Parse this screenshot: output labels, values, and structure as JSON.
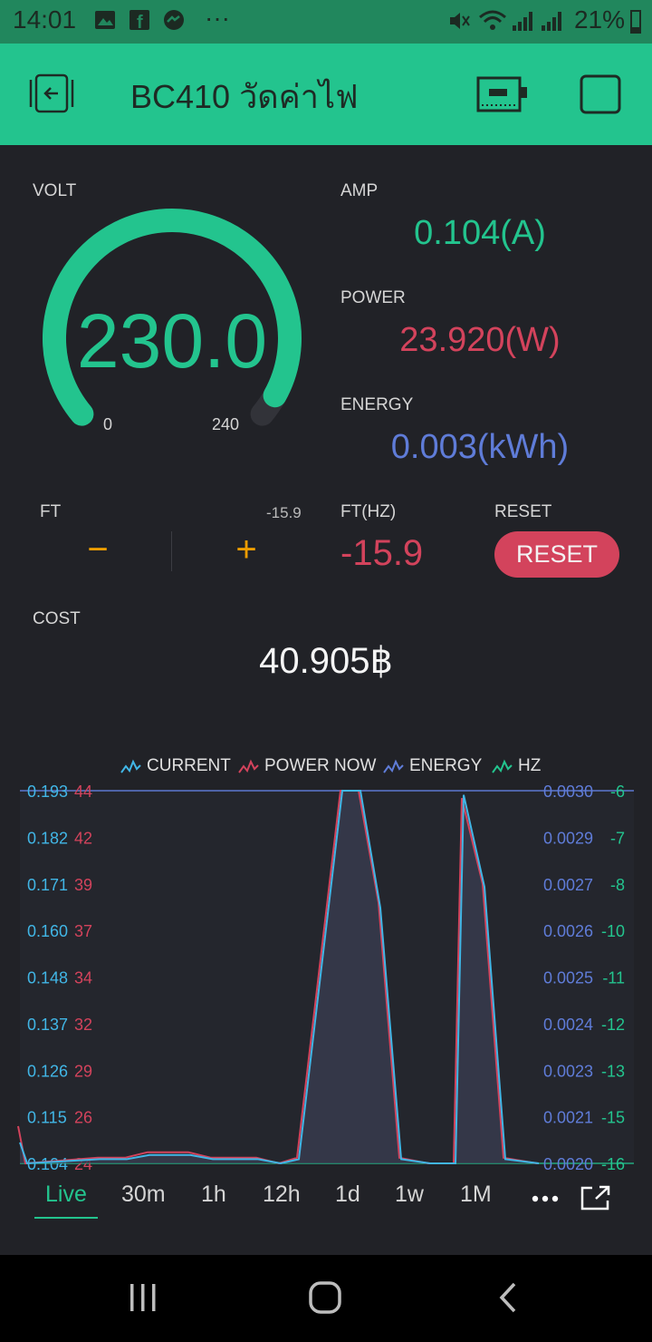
{
  "status_bar": {
    "time": "14:01",
    "dots": "···",
    "battery": "21%"
  },
  "app": {
    "title": "BC410 วัดค่าไฟ"
  },
  "volt": {
    "label": "VOLT",
    "value": "230.0",
    "min": "0",
    "max": "240",
    "level_fraction": 0.958,
    "color": "#23c48e"
  },
  "amp": {
    "label": "AMP",
    "value": "0.104(A)",
    "color": "#23c48e"
  },
  "power": {
    "label": "POWER",
    "value": "23.920(W)",
    "color": "#d3435c"
  },
  "energy": {
    "label": "ENERGY",
    "value": "0.003(kWh)",
    "color": "#5f7cd8"
  },
  "ft": {
    "label": "FT",
    "current": "-15.9",
    "minus": "−",
    "plus": "+",
    "color": "#ed9d00"
  },
  "ft_hz": {
    "label": "FT(HZ)",
    "value": "-15.9",
    "color": "#d3435c"
  },
  "reset": {
    "label": "RESET",
    "button": "RESET",
    "color": "#d3435c"
  },
  "cost": {
    "label": "COST",
    "value": "40.905฿"
  },
  "chart_data": {
    "type": "line",
    "series": [
      {
        "name": "CURRENT",
        "color": "#41b6e6",
        "axis": "left-outer",
        "y": [
          0.109,
          0.104,
          0.105,
          0.105,
          0.106,
          0.106,
          0.105,
          0.105,
          0.104,
          0.105,
          0.193,
          0.193,
          0.165,
          0.105,
          0.104,
          0.104,
          0.192,
          0.17,
          0.105,
          0.104
        ]
      },
      {
        "name": "POWER NOW",
        "color": "#d3435c",
        "axis": "left-inner",
        "y": [
          26,
          24,
          24.3,
          24.3,
          24.6,
          24.6,
          24.3,
          24.3,
          24,
          24.3,
          44,
          44,
          38,
          24.3,
          24,
          24,
          43.6,
          39,
          24.3,
          24
        ]
      },
      {
        "name": "ENERGY",
        "color": "#5f7cd8",
        "axis": "right-inner"
      },
      {
        "name": "HZ",
        "color": "#23c48e",
        "axis": "right-outer"
      }
    ],
    "axes": {
      "left_outer": [
        "0.193",
        "0.182",
        "0.171",
        "0.160",
        "0.148",
        "0.137",
        "0.126",
        "0.115",
        "0.104"
      ],
      "left_inner": [
        "44",
        "42",
        "39",
        "37",
        "34",
        "32",
        "29",
        "26",
        "24"
      ],
      "right_inner": [
        "0.0030",
        "0.0029",
        "0.0027",
        "0.0026",
        "0.0025",
        "0.0024",
        "0.0023",
        "0.0021",
        "0.0020"
      ],
      "right_outer": [
        "-6",
        "-7",
        "-8",
        "-10",
        "-11",
        "-12",
        "-13",
        "-15",
        "-16"
      ],
      "ylim_current": [
        0.104,
        0.193
      ]
    },
    "legend_position": "top"
  },
  "ranges": [
    "Live",
    "30m",
    "1h",
    "12h",
    "1d",
    "1w",
    "1M"
  ],
  "range_selected": "Live",
  "colors": {
    "brand": "#23c48e",
    "background": "#212227",
    "status_bar": "#21875d"
  }
}
